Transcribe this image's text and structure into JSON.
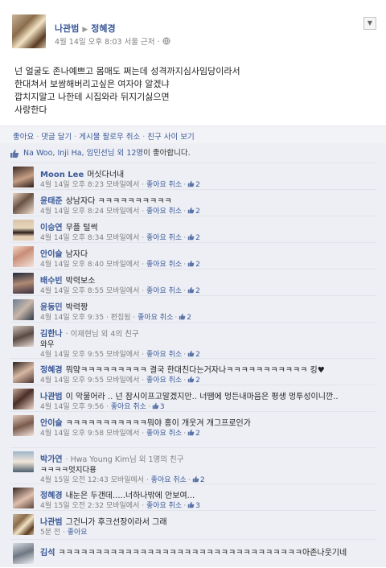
{
  "post": {
    "author": "나관범",
    "arrow": "▶",
    "target": "정혜경",
    "meta": "4월 14일 오후 8:03 서울 근처 · ",
    "lines": [
      "넌 얼굴도 존나예쁘고 몸매도 쩌는데 성격까지심사임당이라서",
      "한대쳐서 보쌈해버리고싶은 여자야 알겠냐",
      "깝치지말고 나한테 시집와라 뒤지기싫으면",
      "사랑한다"
    ],
    "actions": [
      "좋아요",
      "댓글 달기",
      "게시물 팔로우 취소",
      "친구 사이 보기"
    ],
    "likes": {
      "names": "Na Woo, Inji Ha, 임민선님 외 12명",
      "suffix": "이 좋아합니다."
    }
  },
  "comments": [
    {
      "name": "Moon Lee",
      "text": "머싯다너내",
      "meta": "4월 14일 오후 8:23 모바일에서 · ",
      "action": "좋아요 취소",
      "likes": "2"
    },
    {
      "name": "윤태준",
      "text": "상남자다 ㅋㅋㅋㅋㅋㅋㅋㅋㅋㅋ",
      "meta": "4월 14일 오후 8:24 모바일에서 · ",
      "action": "좋아요 취소",
      "likes": "2"
    },
    {
      "name": "이승연",
      "text": "무플 털썩",
      "meta": "4월 14일 오후 8:34 모바일에서 · ",
      "action": "좋아요 취소",
      "likes": "2"
    },
    {
      "name": "안이슬",
      "text": "남자다",
      "meta": "4월 14일 오후 8:40 모바일에서 · ",
      "action": "좋아요 취소",
      "likes": "2"
    },
    {
      "name": "배수빈",
      "text": "박력보소",
      "meta": "4월 14일 오후 8:55 모바일에서 · ",
      "action": "좋아요 취소",
      "likes": "2"
    },
    {
      "name": "윤동민",
      "text": "박력짱",
      "meta": "4월 14일 오후 9:35 · 편집됨 · ",
      "action": "좋아요 취소",
      "likes": "2"
    },
    {
      "name": "김한나",
      "extra": "· 이재현님 외 4의 친구",
      "line2": "와우",
      "meta": "4월 14일 오후 9:55 모바일에서 · ",
      "action": "좋아요 취소",
      "likes": "2"
    },
    {
      "name": "정혜경",
      "text": "뭐얔ㅋㅋㅋㅋㅋㅋㅋㅋㅋ 결국 한대친다는거자나ㅋㅋㅋㅋㅋㅋㅋㅋㅋㅋㅋ 킹♥",
      "meta": "4월 14일 오후 9:55 모바일에서 · ",
      "action": "좋아요 취소",
      "likes": "2"
    },
    {
      "name": "나관범",
      "text": "이 악물어라 .. 넌 잠시이프고말겠지만.. 너땜에 멍든내마음은 평생 멍투성이니깐..",
      "meta": "4월 14일 오후 9:56 · ",
      "action": "좋아요 취소",
      "likes": "3"
    },
    {
      "name": "안이슬",
      "text": "ㅋㅋㅋㅋㅋㅋㅋㅋㅋㅋㅋ뭐야 홍이 개웃겨 개그프로인가",
      "meta": "4월 14일 오후 9:58 모바일에서 · ",
      "action": "좋아요 취소",
      "likes": "2"
    },
    {
      "name": "박가연",
      "extra": "· Hwa Young Kim님 외 1명의 친구",
      "line2": "ㅋㅋㅋㅋ멋지다용",
      "meta": "4월 15일 오전 12:43 모바일에서 · ",
      "action": "좋아요 취소",
      "likes": "2"
    },
    {
      "name": "정혜경",
      "text": "내눈은 두갠데.....너하나밖에 안보여...",
      "meta": "4월 15일 오전 2:32 모바일에서 · ",
      "action": "좋아요 취소",
      "likes": "3"
    },
    {
      "name": "나관범",
      "text": "그건니가 후크선장이라서 그래",
      "meta": "5분 전 · ",
      "action": "좋아요",
      "likes": ""
    },
    {
      "name": "김석",
      "text": "ㅋㅋㅋㅋㅋㅋㅋㅋㅋㅋㅋㅋㅋㅋㅋㅋㅋㅋㅋㅋㅋㅋㅋㅋㅋㅋㅋㅋㅋㅋㅋㅋㅋ아존나웃기네",
      "meta": "",
      "action": "",
      "likes": ""
    }
  ],
  "colors": {
    "link": "#3b5998",
    "feed_bg": "#edeff4",
    "action_bar": "#f2f3f7"
  }
}
